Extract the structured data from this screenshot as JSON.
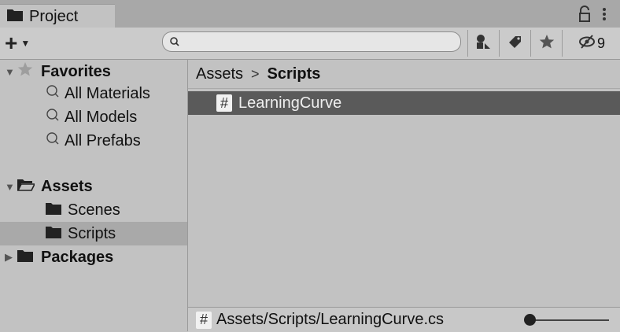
{
  "window": {
    "tab_label": "Project",
    "tab_icon": "folder-icon",
    "header_icons": [
      "lock-icon",
      "kebab-menu-icon"
    ]
  },
  "toolbar": {
    "create_icon": "plus-icon",
    "search": {
      "placeholder": "",
      "value": "",
      "icon": "search-icon"
    },
    "buttons": [
      {
        "name": "search-by-type",
        "icon": "shapes-icon"
      },
      {
        "name": "search-by-label",
        "icon": "tag-icon"
      },
      {
        "name": "favorites-filter",
        "icon": "star-icon"
      },
      {
        "name": "hidden-packages",
        "icon": "eye-slash-icon",
        "count": "9"
      }
    ]
  },
  "sidebar": {
    "favorites": {
      "label": "Favorites",
      "items": [
        "All Materials",
        "All Models",
        "All Prefabs"
      ]
    },
    "assets": {
      "label": "Assets",
      "children": [
        "Scenes",
        "Scripts"
      ],
      "selected": "Scripts"
    },
    "packages": {
      "label": "Packages"
    }
  },
  "main": {
    "breadcrumb": {
      "root": "Assets",
      "separator": ">",
      "current": "Scripts"
    },
    "items": [
      {
        "icon": "csharp-script-icon",
        "glyph": "#",
        "label": "LearningCurve",
        "selected": true
      }
    ]
  },
  "footer": {
    "glyph": "#",
    "path": "Assets/Scripts/LearningCurve.cs",
    "zoom_slider": 0.0
  },
  "colors": {
    "panel": "#c2c2c2",
    "topbar": "#a8a8a8",
    "selected_row": "#5a5a5a",
    "sidebar_selected": "#a9a9a9"
  }
}
